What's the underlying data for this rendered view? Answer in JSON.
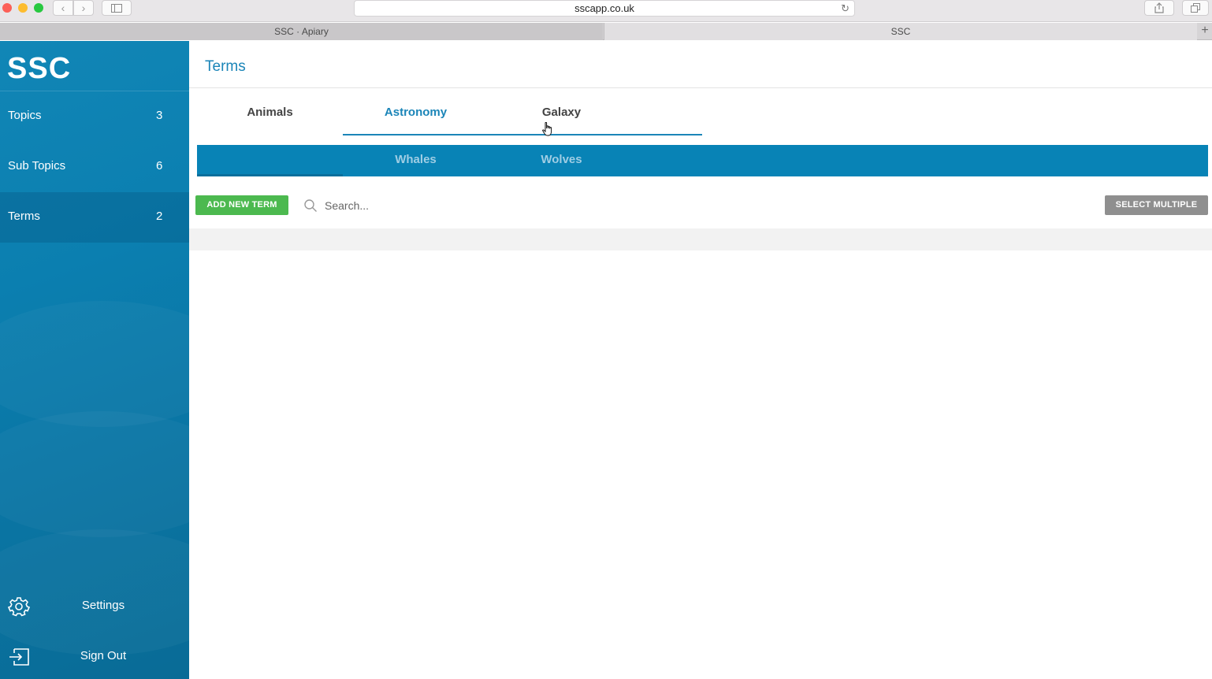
{
  "browser": {
    "url": "sscapp.co.uk",
    "tabs": [
      {
        "label": "SSC · Apiary"
      },
      {
        "label": "SSC"
      }
    ]
  },
  "sidebar": {
    "logo": "SSC",
    "items": [
      {
        "label": "Topics",
        "count": "3"
      },
      {
        "label": "Sub Topics",
        "count": "6"
      },
      {
        "label": "Terms",
        "count": "2"
      }
    ],
    "settings_label": "Settings",
    "signout_label": "Sign Out"
  },
  "main": {
    "title": "Terms",
    "category_tabs": [
      {
        "label": "Animals"
      },
      {
        "label": "Astronomy"
      },
      {
        "label": "Galaxy"
      }
    ],
    "sub_tabs": [
      {
        "label": ""
      },
      {
        "label": "Whales"
      },
      {
        "label": "Wolves"
      }
    ],
    "add_button": "ADD NEW TERM",
    "search_placeholder": "Search...",
    "select_multiple": "SELECT MULTIPLE"
  },
  "colors": {
    "accent": "#1b85b8",
    "sidebar": "#0b7fb0",
    "add_button": "#4cb94f",
    "multi_button": "#8f8f8f"
  }
}
